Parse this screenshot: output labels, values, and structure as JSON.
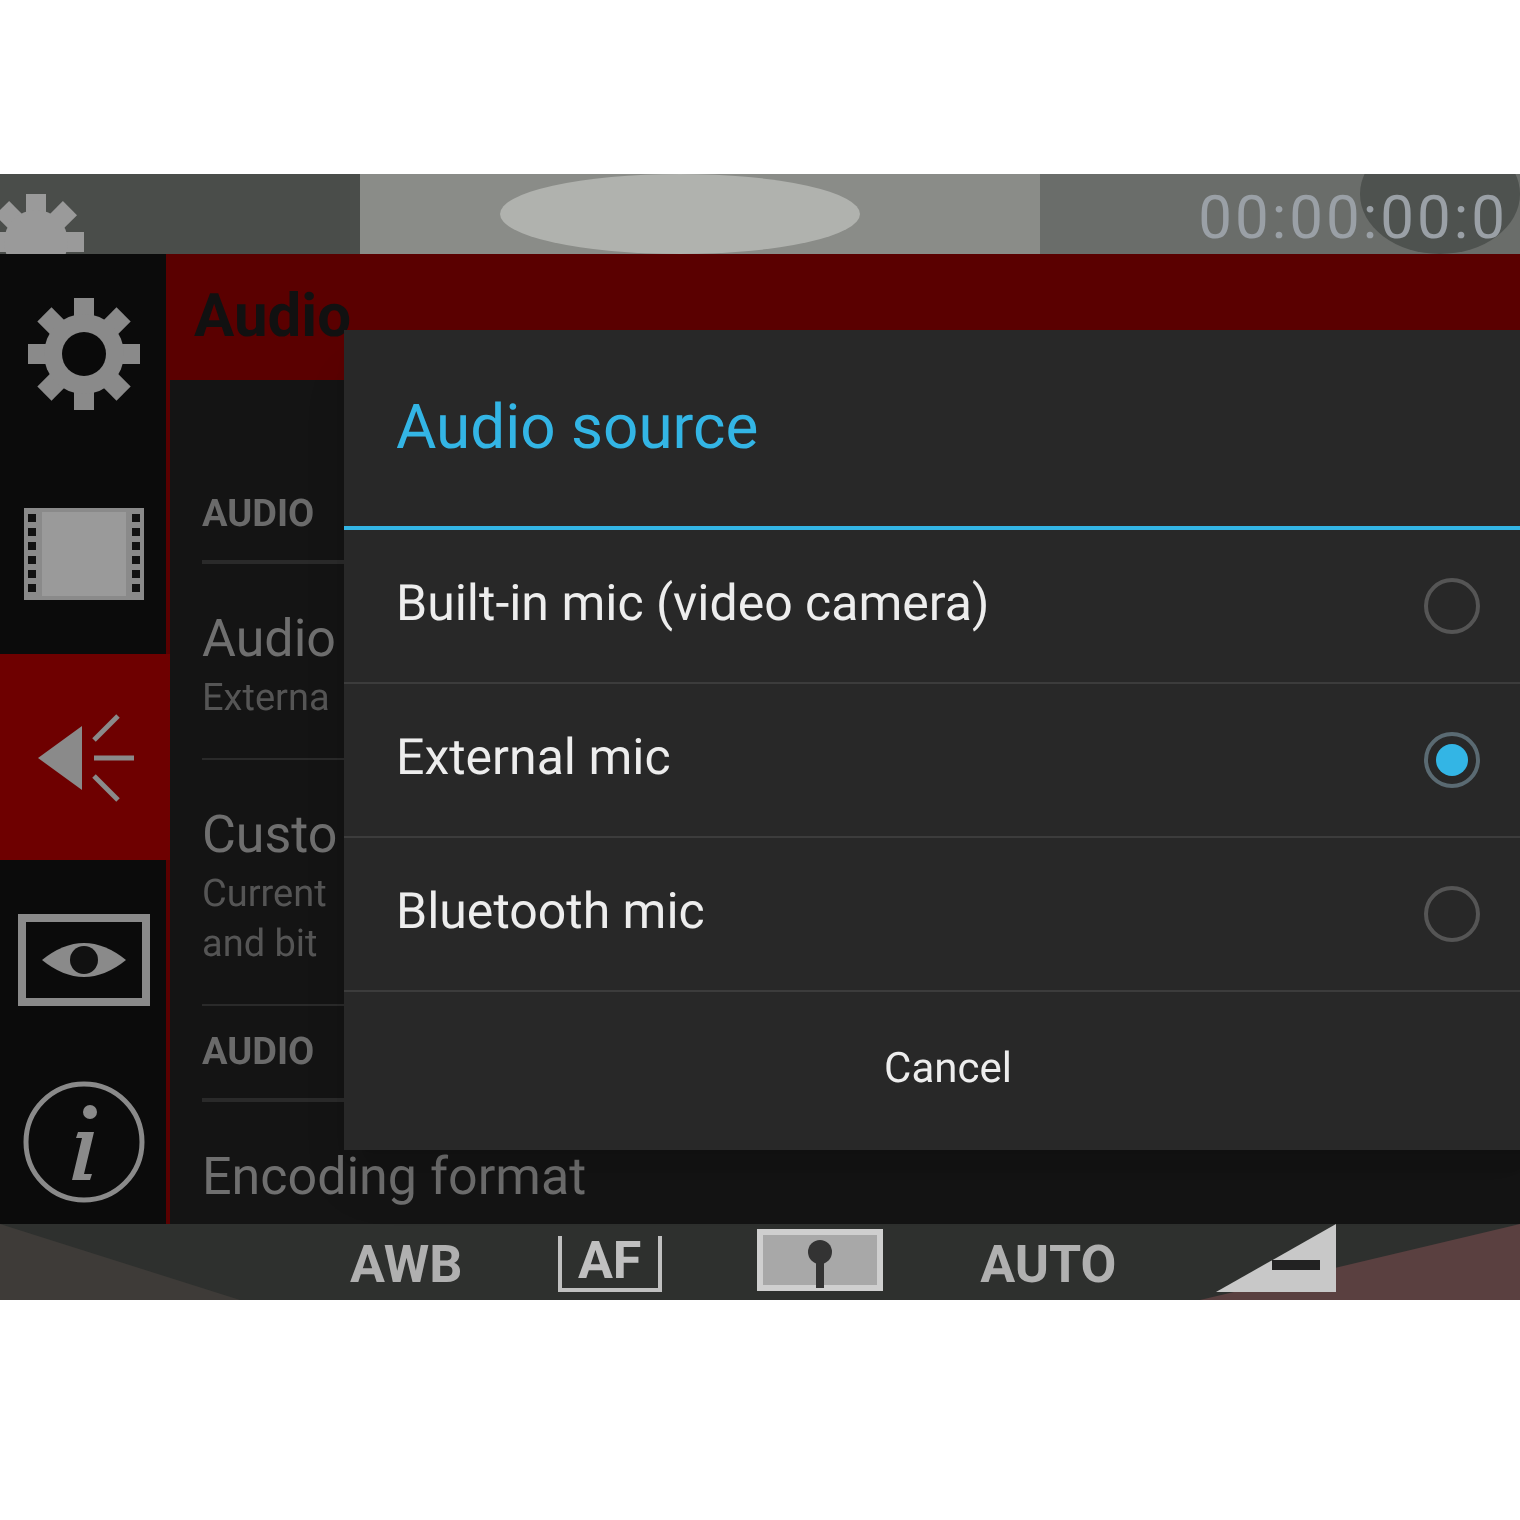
{
  "camera": {
    "timer": "00:00:00:0",
    "toolbar": [
      {
        "kind": "text",
        "label": "AWB"
      },
      {
        "kind": "af",
        "label": "AF"
      },
      {
        "kind": "metering"
      },
      {
        "kind": "text",
        "label": "AUTO"
      },
      {
        "kind": "exposure"
      }
    ]
  },
  "sidebar": {
    "items": [
      {
        "kind": "settings",
        "selected": false
      },
      {
        "kind": "video",
        "selected": false
      },
      {
        "kind": "audio",
        "selected": true
      },
      {
        "kind": "preview",
        "selected": false
      },
      {
        "kind": "info",
        "selected": false
      }
    ]
  },
  "settings": {
    "title": "Audio",
    "rows": [
      {
        "kind": "header",
        "title": "AUDIO"
      },
      {
        "kind": "item",
        "title": "Audio",
        "summary": [
          "Externa"
        ]
      },
      {
        "kind": "item",
        "title": "Custo",
        "summary": [
          "Current",
          "and bit"
        ]
      },
      {
        "kind": "header",
        "title": "AUDIO"
      },
      {
        "kind": "item",
        "title": "Encoding format"
      }
    ]
  },
  "dialog": {
    "title": "Audio source",
    "options": [
      {
        "label": "Built-in mic (video camera)",
        "selected": false
      },
      {
        "label": "External mic",
        "selected": true
      },
      {
        "label": "Bluetooth mic",
        "selected": false
      }
    ],
    "button": "Cancel"
  }
}
